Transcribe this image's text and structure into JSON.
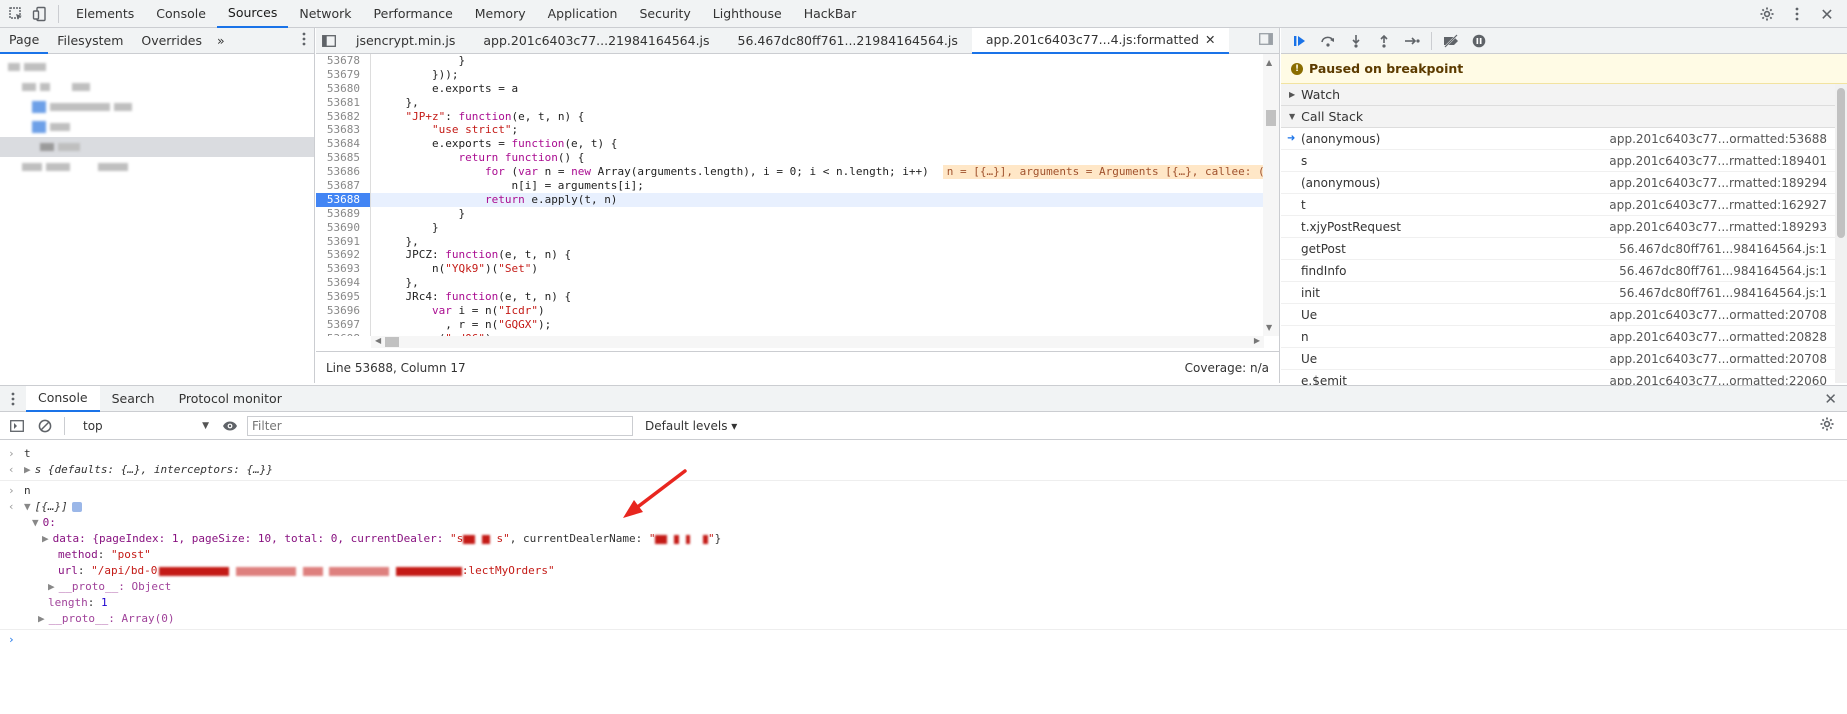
{
  "toolbar": {
    "tabs": [
      "Elements",
      "Console",
      "Sources",
      "Network",
      "Performance",
      "Memory",
      "Application",
      "Security",
      "Lighthouse",
      "HackBar"
    ],
    "active_tab": "Sources"
  },
  "navigator": {
    "tabs": [
      "Page",
      "Filesystem",
      "Overrides"
    ],
    "more": "»"
  },
  "editor": {
    "file_tabs": [
      "jsencrypt.min.js",
      "app.201c6403c77...21984164564.js",
      "56.467dc80ff761...21984164564.js",
      "app.201c6403c77...4.js:formatted"
    ],
    "active_file": "app.201c6403c77...4.js:formatted",
    "lines": [
      {
        "n": "53678",
        "code": "            }"
      },
      {
        "n": "53679",
        "code": "        }));"
      },
      {
        "n": "53680",
        "code": "        e.exports = a"
      },
      {
        "n": "53681",
        "code": "    },"
      },
      {
        "n": "53682",
        "code": "    \"JP+z\": function(e, t, n) {"
      },
      {
        "n": "53683",
        "code": "        \"use strict\";"
      },
      {
        "n": "53684",
        "code": "        e.exports = function(e, t) {"
      },
      {
        "n": "53685",
        "code": "            return function() {"
      },
      {
        "n": "53686",
        "code": "                for (var n = new Array(arguments.length), i = 0; i < n.length; i++)",
        "inline": "n = [{…}], arguments = Arguments [{…}, callee: (..."
      },
      {
        "n": "53687",
        "code": "                    n[i] = arguments[i];"
      },
      {
        "n": "53688",
        "code": "                return e.apply(t, n)",
        "current": true
      },
      {
        "n": "53689",
        "code": "            }"
      },
      {
        "n": "53690",
        "code": "        }"
      },
      {
        "n": "53691",
        "code": "    },"
      },
      {
        "n": "53692",
        "code": "    JPCZ: function(e, t, n) {"
      },
      {
        "n": "53693",
        "code": "        n(\"YQk9\")(\"Set\")"
      },
      {
        "n": "53694",
        "code": "    },"
      },
      {
        "n": "53695",
        "code": "    JRc4: function(e, t, n) {"
      },
      {
        "n": "53696",
        "code": "        var i = n(\"Icdr\")"
      },
      {
        "n": "53697",
        "code": "          , r = n(\"GQGX\");"
      },
      {
        "n": "53698",
        "code": "        n(\"od06\"),"
      },
      {
        "n": "53699",
        "code": "        ..."
      }
    ],
    "status_left": "Line 53688, Column 17",
    "status_right": "Coverage: n/a"
  },
  "debugger": {
    "paused_label": "Paused on breakpoint",
    "watch_label": "Watch",
    "callstack_label": "Call Stack",
    "frames": [
      {
        "name": "(anonymous)",
        "loc": "app.201c6403c77...ormatted:53688",
        "selected": true
      },
      {
        "name": "s",
        "loc": "app.201c6403c77...rmatted:189401"
      },
      {
        "name": "(anonymous)",
        "loc": "app.201c6403c77...rmatted:189294"
      },
      {
        "name": "t",
        "loc": "app.201c6403c77...rmatted:162927"
      },
      {
        "name": "t.xjyPostRequest",
        "loc": "app.201c6403c77...rmatted:189293"
      },
      {
        "name": "getPost",
        "loc": "56.467dc80ff761...984164564.js:1"
      },
      {
        "name": "findInfo",
        "loc": "56.467dc80ff761...984164564.js:1"
      },
      {
        "name": "init",
        "loc": "56.467dc80ff761...984164564.js:1"
      },
      {
        "name": "Ue",
        "loc": "app.201c6403c77...ormatted:20708"
      },
      {
        "name": "n",
        "loc": "app.201c6403c77...ormatted:20828"
      },
      {
        "name": "Ue",
        "loc": "app.201c6403c77...ormatted:20708"
      },
      {
        "name": "e.$emit",
        "loc": "app.201c6403c77...ormatted:22060"
      }
    ]
  },
  "drawer": {
    "tabs": [
      "Console",
      "Search",
      "Protocol monitor"
    ],
    "context": "top",
    "filter_placeholder": "Filter",
    "levels": "Default levels ▾",
    "lines": {
      "l1_in": "t",
      "l2_out": "s {defaults: {…}, interceptors: {…}}",
      "l3_in": "n",
      "l4_out": "[{…}]",
      "l5": "0:",
      "l6_prefix": "data: {pageIndex: 1, pageSize: 10, total: 0, currentDealer: ",
      "l6_mid": ", currentDealerName: ",
      "l6_end": "}",
      "l7_key": "method",
      "l7_val": "\"post\"",
      "l8_key": "url",
      "l8_val_start": "\"/api/bd-0",
      "l8_val_end": ":lectMyOrders\"",
      "l9": "__proto__: Object",
      "l10_key": "length",
      "l10_val": "1",
      "l11": "__proto__: Array(0)"
    }
  },
  "colors": {
    "accent": "#1a73e8",
    "arrow": "#e8261f"
  }
}
